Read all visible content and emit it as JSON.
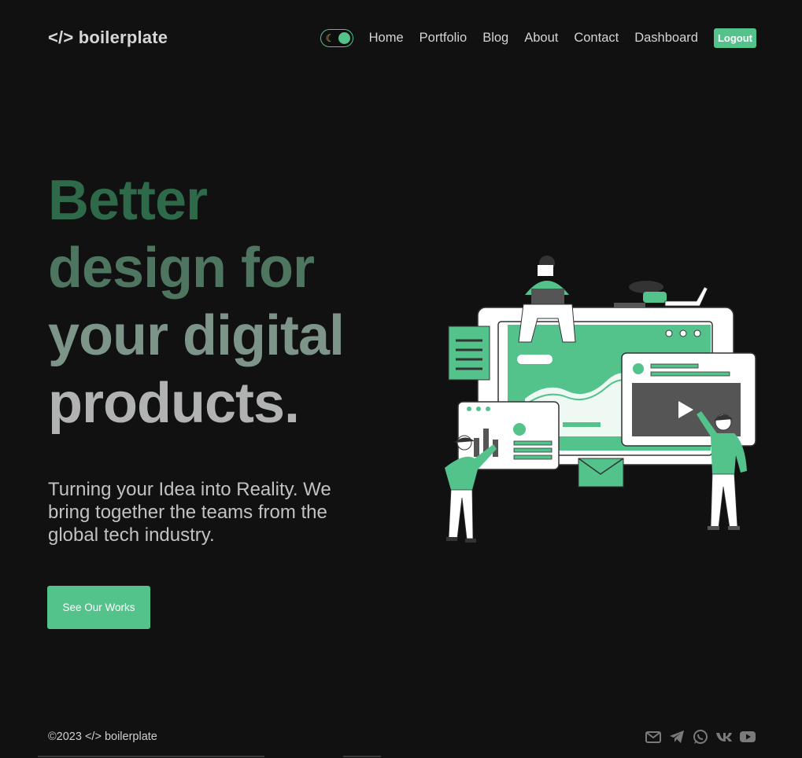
{
  "brand": {
    "logo": "</> boilerplate"
  },
  "nav": {
    "theme_toggle_icon": "moon-icon",
    "links": [
      "Home",
      "Portfolio",
      "Blog",
      "About",
      "Contact",
      "Dashboard"
    ],
    "logout_label": "Logout"
  },
  "hero": {
    "title_lines": [
      "Better",
      "design for",
      "your digital",
      "products."
    ],
    "description": "Turning your Idea into Reality. We bring together the teams from the global tech industry.",
    "cta_label": "See Our Works",
    "illustration_icon": "team-working-on-website-illustration"
  },
  "footer": {
    "copyright": "©2023 </> boilerplate",
    "social_icons": [
      "mail-icon",
      "telegram-icon",
      "whatsapp-icon",
      "vk-icon",
      "youtube-icon"
    ]
  },
  "colors": {
    "background": "#111111",
    "accent": "#53c28b",
    "title_gradient": [
      "#2e6a4a",
      "#4e7560",
      "#7d9488",
      "#b0b3b1"
    ]
  }
}
